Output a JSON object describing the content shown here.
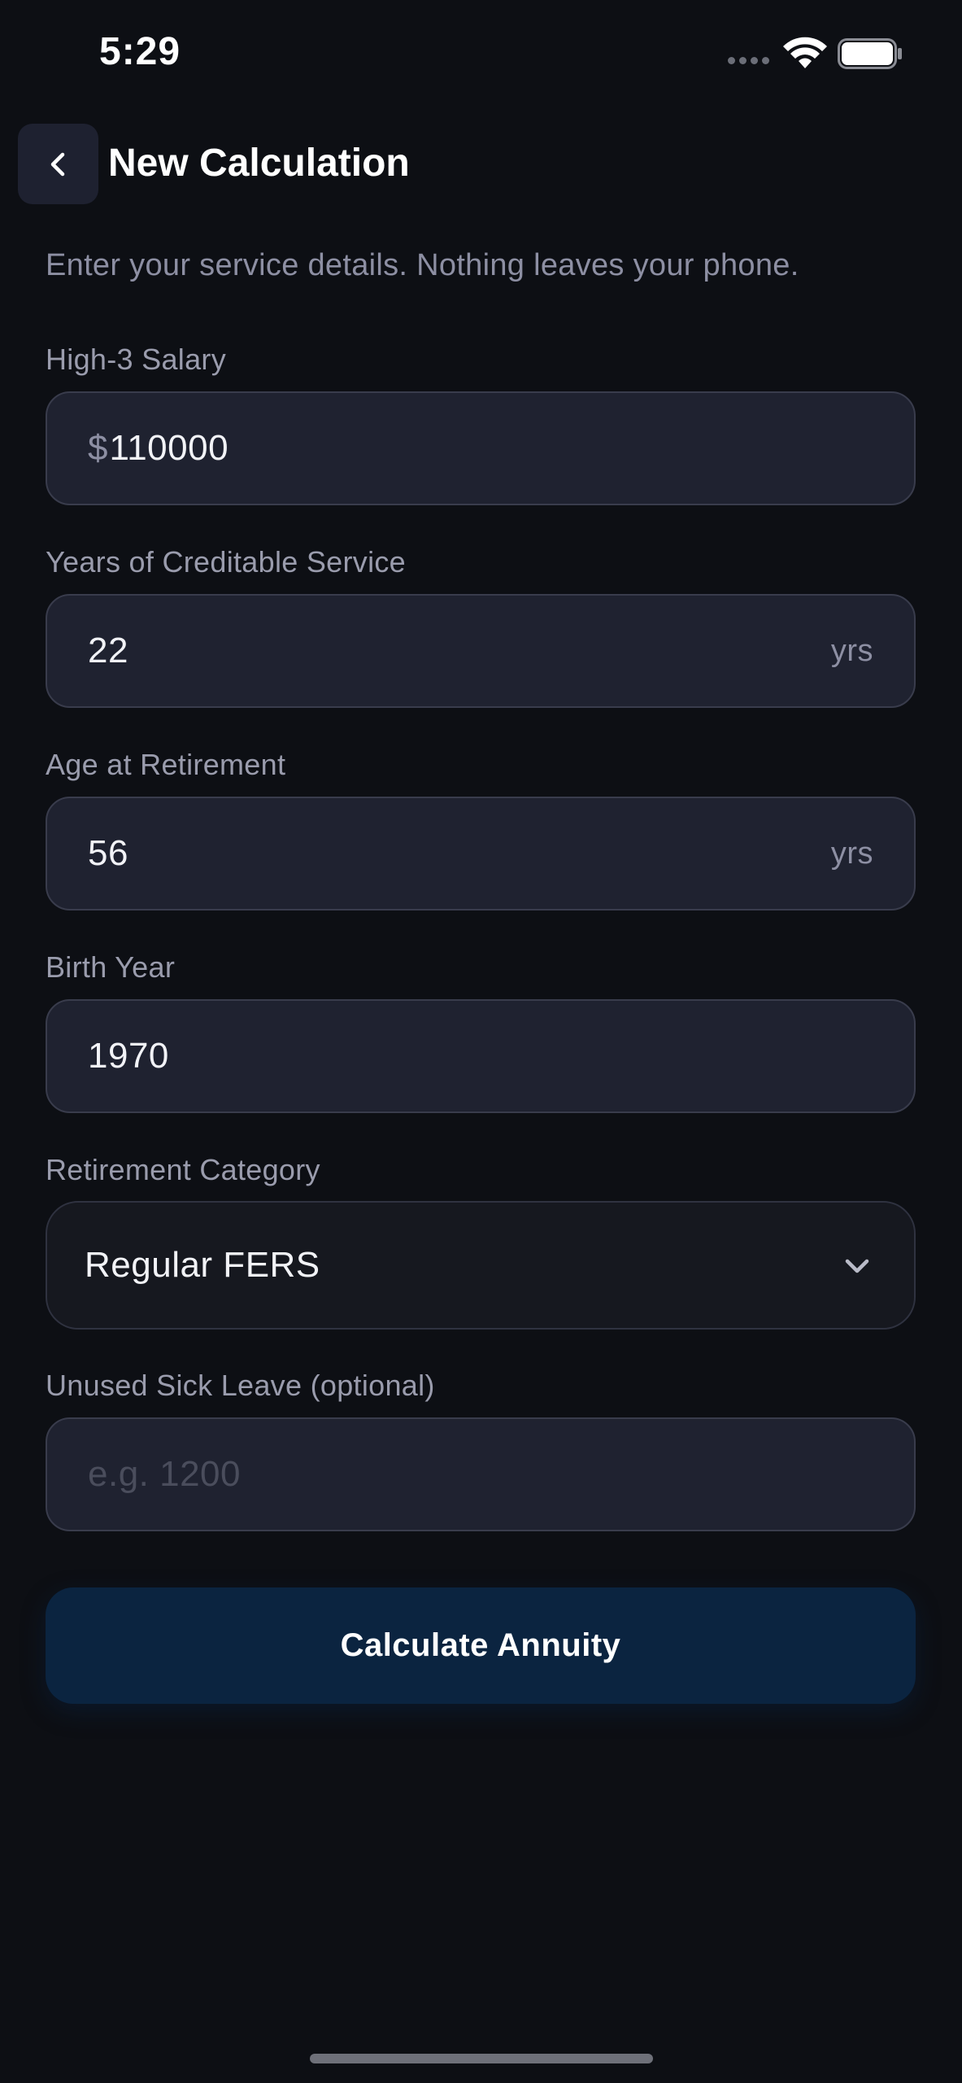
{
  "status_bar": {
    "time": "5:29"
  },
  "header": {
    "back_icon": "chevron-left-icon",
    "title": "New Calculation"
  },
  "subtitle": "Enter your service details. Nothing leaves your phone.",
  "form": {
    "salary": {
      "label": "High-3 Salary",
      "prefix": "$",
      "value": "110000"
    },
    "service_years": {
      "label": "Years of Creditable Service",
      "value": "22",
      "suffix": "yrs"
    },
    "retirement_age": {
      "label": "Age at Retirement",
      "value": "56",
      "suffix": "yrs"
    },
    "birth_year": {
      "label": "Birth Year",
      "value": "1970"
    },
    "retirement_category": {
      "label": "Retirement Category",
      "selected": "Regular FERS"
    },
    "sick_leave": {
      "label": "Unused Sick Leave (optional)",
      "value": "",
      "placeholder": "e.g. 1200"
    }
  },
  "actions": {
    "calculate_label": "Calculate Annuity"
  },
  "colors": {
    "background": "#0d0f14",
    "field_background": "#1f2230",
    "primary_button": "#0b2440",
    "label_text": "#9a9cad"
  }
}
